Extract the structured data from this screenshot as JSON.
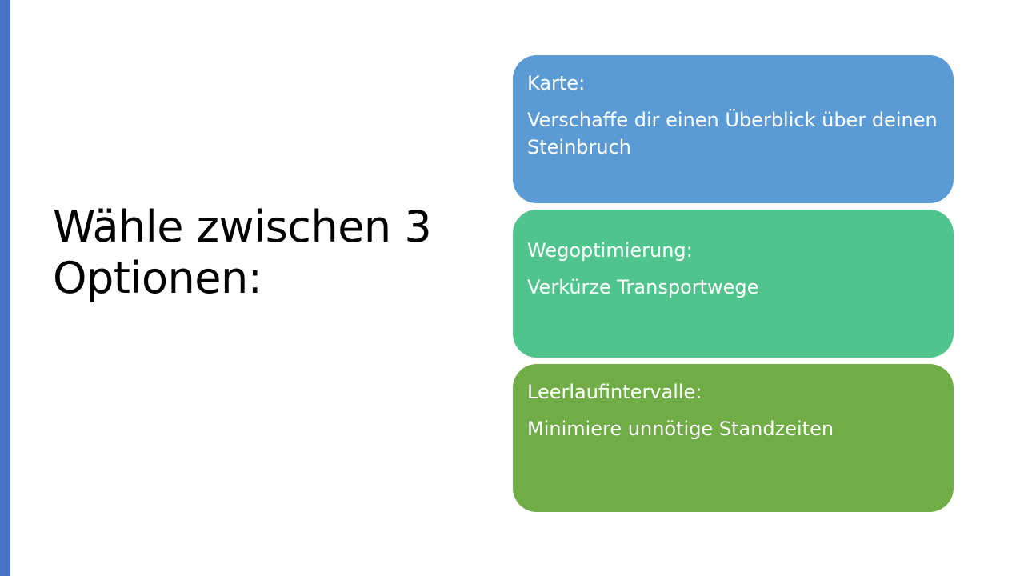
{
  "slide": {
    "title": "Wähle zwischen 3 Optionen:",
    "accent_color": "#4472c4"
  },
  "options": [
    {
      "title": "Karte:",
      "description": "Verschaffe dir einen Überblick über deinen Steinbruch",
      "color": "#5b9bd5"
    },
    {
      "title": "Wegoptimierung:",
      "description": "Verkürze Transportwege",
      "color": "#4fc58d"
    },
    {
      "title": "Leerlaufintervalle:",
      "description": "Minimiere unnötige Standzeiten",
      "color": "#70ad47"
    }
  ]
}
